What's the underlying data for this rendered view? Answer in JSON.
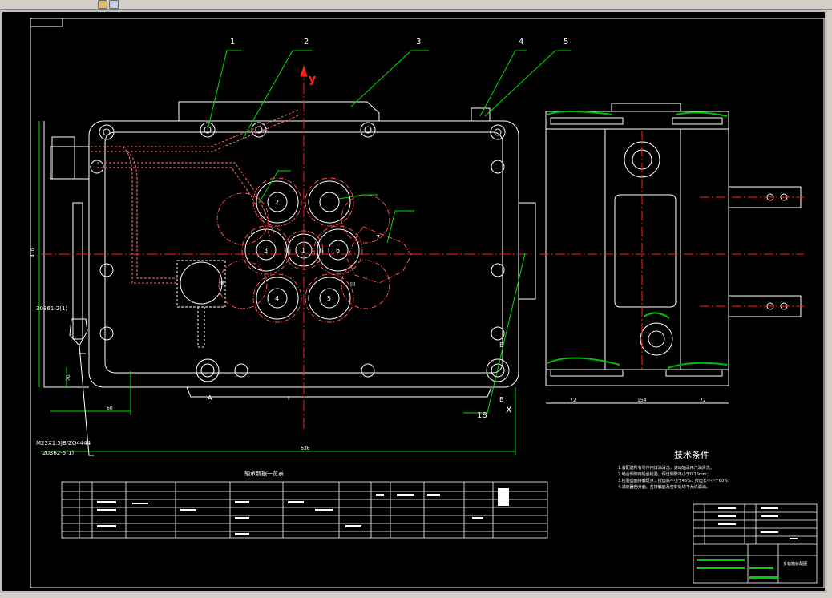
{
  "window": {
    "title": ""
  },
  "drawing": {
    "part_numbers": [
      "1",
      "2",
      "3",
      "4",
      "5",
      "18"
    ],
    "axis": {
      "y": "y",
      "x": "X"
    },
    "section_marks": {
      "a": "A",
      "b": "B"
    },
    "roman_marks": [
      "I",
      "II",
      "III",
      "I",
      "II",
      "III"
    ],
    "shaft_numbers": [
      "1",
      "2",
      "3",
      "4",
      "5",
      "6",
      "7"
    ],
    "left_labels": [
      "30361-2(1)",
      "M22X1.5JB/ZQ4444",
      "20362-5(1)"
    ],
    "dims": {
      "width": "636",
      "height": "410",
      "small_a": "60",
      "small_b": "70"
    },
    "right_dims": [
      "72",
      "154",
      "72"
    ],
    "table_title": "轴承数据一览表",
    "tech_title": "技术条件",
    "tech_notes": [
      "1.装配前所有零件用煤油清洗，滚动轴承用汽油清洗，",
      "2.啮合侧隙用铅丝检验，保证侧隙不小于0.16mm；",
      "3.检验齿面接触斑点，按齿高不小于45%，按齿长不小于60%；",
      "4.减速器剖分面、各接触面及密封处均不允许漏油。"
    ],
    "title_block": {
      "name": "多轴箱装配图"
    },
    "colors": {
      "bg": "#000000",
      "outline": "#ffffff",
      "axis": "#ff2020",
      "leader": "#00e000",
      "part": "#ff6060"
    }
  }
}
